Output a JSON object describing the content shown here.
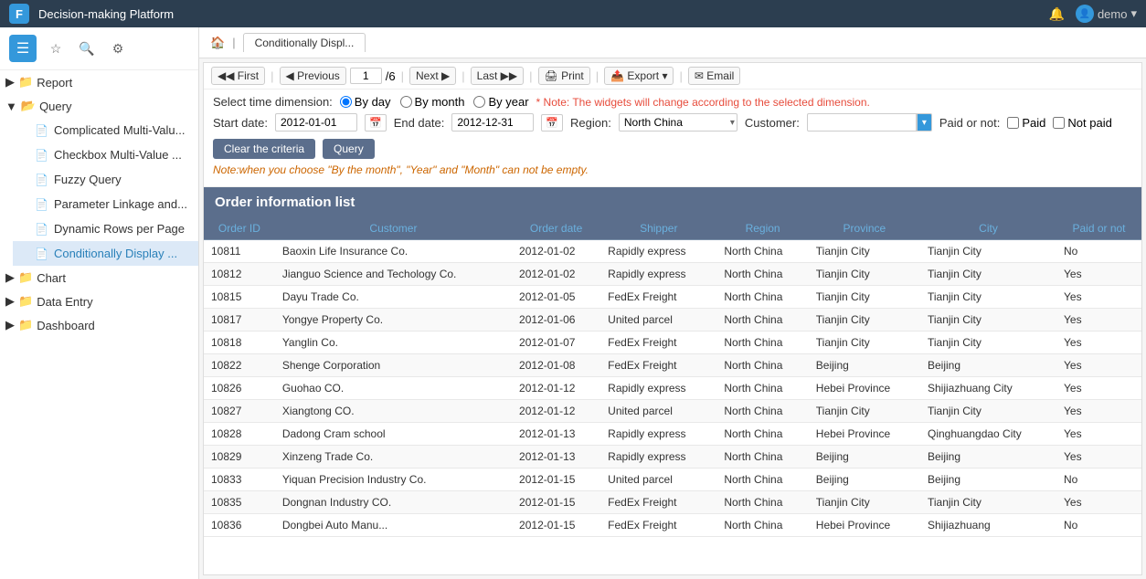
{
  "app": {
    "title": "Decision-making Platform",
    "user": "demo",
    "logo": "F"
  },
  "topbar": {
    "bell_icon": "🔔",
    "user_icon": "👤",
    "chevron_icon": "▾"
  },
  "sidebar": {
    "menu_icon": "☰",
    "star_icon": "☆",
    "search_icon": "🔍",
    "settings_icon": "⚙",
    "sections": [
      {
        "label": "Report",
        "icon": "▶",
        "expanded": false
      },
      {
        "label": "Query",
        "icon": "▼",
        "expanded": true,
        "children": [
          {
            "label": "Complicated Multi-Valu...",
            "icon": "📄",
            "active": false
          },
          {
            "label": "Checkbox Multi-Value ...",
            "icon": "📄",
            "active": false
          },
          {
            "label": "Fuzzy Query",
            "icon": "📄",
            "active": false
          },
          {
            "label": "Parameter Linkage and...",
            "icon": "📄",
            "active": false
          },
          {
            "label": "Dynamic Rows per Page",
            "icon": "📄",
            "active": false
          },
          {
            "label": "Conditionally Display ...",
            "icon": "📄",
            "active": true
          }
        ]
      },
      {
        "label": "Chart",
        "icon": "▶",
        "expanded": false
      },
      {
        "label": "Data Entry",
        "icon": "▶",
        "expanded": false
      },
      {
        "label": "Dashboard",
        "icon": "▶",
        "expanded": false
      }
    ]
  },
  "breadcrumb": {
    "home_icon": "🏠",
    "tab_label": "Conditionally Displ..."
  },
  "toolbar": {
    "first_label": "◀◀ First",
    "prev_label": "◀ Previous",
    "page_current": "1",
    "page_total": "/6",
    "next_label": "Next ▶",
    "last_label": "Last ▶▶",
    "print_label": "🖨 Print",
    "export_label": "📤 Export ▾",
    "email_label": "✉ Email"
  },
  "filters": {
    "time_dimension_label": "Select time dimension:",
    "by_day_label": "By day",
    "by_month_label": "By month",
    "by_year_label": "By year",
    "note_label": "* Note: The widgets will change according to the selected dimension.",
    "start_date_label": "Start date:",
    "start_date_value": "2012-01-01",
    "end_date_label": "End date:",
    "end_date_value": "2012-12-31",
    "region_label": "Region:",
    "region_value": "North China",
    "customer_label": "Customer:",
    "customer_value": "",
    "paid_label": "Paid or not:",
    "paid_checkbox_label": "Paid",
    "not_paid_checkbox_label": "Not paid",
    "clear_btn_label": "Clear the criteria",
    "query_btn_label": "Query",
    "warn_note": "Note:when you choose \"By the month\", \"Year\" and \"Month\" can not be empty."
  },
  "table": {
    "title": "Order information list",
    "columns": [
      "Order ID",
      "Customer",
      "Order date",
      "Shipper",
      "Region",
      "Province",
      "City",
      "Paid or not"
    ],
    "rows": [
      {
        "id": "10811",
        "customer": "Baoxin Life Insurance Co.",
        "order_date": "2012-01-02",
        "shipper": "Rapidly express",
        "region": "North China",
        "province": "Tianjin City",
        "city": "Tianjin City",
        "paid": "No"
      },
      {
        "id": "10812",
        "customer": "Jianguo Science and Techology Co.",
        "order_date": "2012-01-02",
        "shipper": "Rapidly express",
        "region": "North China",
        "province": "Tianjin City",
        "city": "Tianjin City",
        "paid": "Yes"
      },
      {
        "id": "10815",
        "customer": "Dayu Trade Co.",
        "order_date": "2012-01-05",
        "shipper": "FedEx Freight",
        "region": "North China",
        "province": "Tianjin City",
        "city": "Tianjin City",
        "paid": "Yes"
      },
      {
        "id": "10817",
        "customer": "Yongye Property Co.",
        "order_date": "2012-01-06",
        "shipper": "United parcel",
        "region": "North China",
        "province": "Tianjin City",
        "city": "Tianjin City",
        "paid": "Yes"
      },
      {
        "id": "10818",
        "customer": "Yanglin Co.",
        "order_date": "2012-01-07",
        "shipper": "FedEx Freight",
        "region": "North China",
        "province": "Tianjin City",
        "city": "Tianjin City",
        "paid": "Yes"
      },
      {
        "id": "10822",
        "customer": "Shenge Corporation",
        "order_date": "2012-01-08",
        "shipper": "FedEx Freight",
        "region": "North China",
        "province": "Beijing",
        "city": "Beijing",
        "paid": "Yes"
      },
      {
        "id": "10826",
        "customer": "Guohao CO.",
        "order_date": "2012-01-12",
        "shipper": "Rapidly express",
        "region": "North China",
        "province": "Hebei Province",
        "city": "Shijiazhuang City",
        "paid": "Yes"
      },
      {
        "id": "10827",
        "customer": "Xiangtong CO.",
        "order_date": "2012-01-12",
        "shipper": "United parcel",
        "region": "North China",
        "province": "Tianjin City",
        "city": "Tianjin City",
        "paid": "Yes"
      },
      {
        "id": "10828",
        "customer": "Dadong Cram school",
        "order_date": "2012-01-13",
        "shipper": "Rapidly express",
        "region": "North China",
        "province": "Hebei Province",
        "city": "Qinghuangdao City",
        "paid": "Yes"
      },
      {
        "id": "10829",
        "customer": "Xinzeng Trade Co.",
        "order_date": "2012-01-13",
        "shipper": "Rapidly express",
        "region": "North China",
        "province": "Beijing",
        "city": "Beijing",
        "paid": "Yes"
      },
      {
        "id": "10833",
        "customer": "Yiquan  Precision Industry Co.",
        "order_date": "2012-01-15",
        "shipper": "United parcel",
        "region": "North China",
        "province": "Beijing",
        "city": "Beijing",
        "paid": "No"
      },
      {
        "id": "10835",
        "customer": "Dongnan Industry CO.",
        "order_date": "2012-01-15",
        "shipper": "FedEx Freight",
        "region": "North China",
        "province": "Tianjin City",
        "city": "Tianjin City",
        "paid": "Yes"
      },
      {
        "id": "10836",
        "customer": "Dongbei Auto Manu...",
        "order_date": "2012-01-15",
        "shipper": "FedEx Freight",
        "region": "North China",
        "province": "Hebei Province",
        "city": "Shijiazhuang",
        "paid": "No"
      }
    ]
  }
}
